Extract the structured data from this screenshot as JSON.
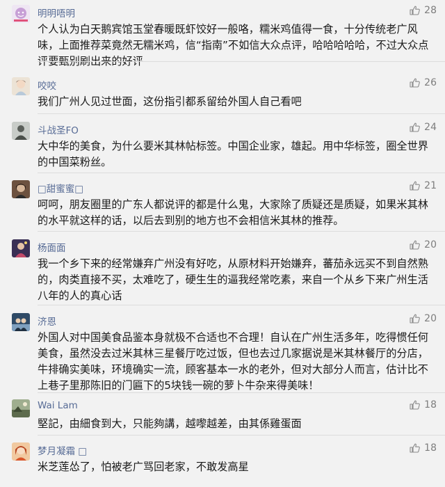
{
  "comments": [
    {
      "username": "明明唔明",
      "likes": "28",
      "text": "个人认为白天鹅宾馆玉堂春暖既虾饺好一般咯，糯米鸡值得一食，十分传统老广风味，上面推荐菜竟然无糯米鸡，信“指南”不如信大众点评，哈哈哈哈哈，不过大众点评要甄别刷出来的好评",
      "avatar_color": "#d9c9e6"
    },
    {
      "username": "咬咬",
      "likes": "26",
      "text": "我们广州人见过世面，这份指引都系留给外国人自己看吧",
      "avatar_color": "#e7d6c3"
    },
    {
      "username": "斗战圣FO",
      "likes": "24",
      "text": "大中华的美食，为什么要米其林帖标签。中国企业家，雄起。用中华标签，圈全世界的中国菜粉丝。",
      "avatar_color": "#9aa09a"
    },
    {
      "username": "□甜蜜蜜□",
      "likes": "21",
      "text": "呵呵，朋友圈里的广东人都说评的都是什么鬼，大家除了质疑还是质疑，如果米其林的水平就这样的话，以后去到别的地方也不会相信米其林的推荐。",
      "avatar_color": "#8a6a4f"
    },
    {
      "username": "杨面面",
      "likes": "20",
      "text": "我一个乡下来的经常嫌弃广州没有好吃，从原材料开始嫌弃，蕃茄永远买不到自然熟的，肉类直接不买，太难吃了，硬生生的逼我经常吃素，来自一个从乡下来广州生活八年的人的真心话",
      "avatar_color": "#5b4a7a"
    },
    {
      "username": "济恩",
      "likes": "20",
      "text": "外国人对中国美食品鉴本身就极不合适也不合理！自认在广州生活多年，吃得惯任何美食，虽然没去过米其林三星餐厅吃过饭，但也去过几家据说是米其林餐厅的分店，牛排确实美味，环境确实一流，顾客基本一水的老外，但对大部分人而言，估计比不上巷子里那陈旧的门匾下的5块钱一碗的萝卜牛杂来得美味！",
      "avatar_color": "#3f5d7a"
    },
    {
      "username": "Wai Lam",
      "likes": "18",
      "text": "堅記，由細食到大，只能夠講，越嚟越差，由其係雞蛋面",
      "avatar_color": "#7a8a6a"
    },
    {
      "username": "梦月凝霜 □",
      "likes": "18",
      "text": "米芝莲怂了，怕被老广骂回老家，不敢发高星",
      "avatar_color": "#c96a3a"
    }
  ],
  "colors": {
    "username": "#576b95",
    "text": "#1a1a1a",
    "like": "#7d7d7d",
    "background": "#f2f2f2"
  },
  "icons": {
    "like": "thumbs-up-icon",
    "avatar": "user-avatar"
  }
}
